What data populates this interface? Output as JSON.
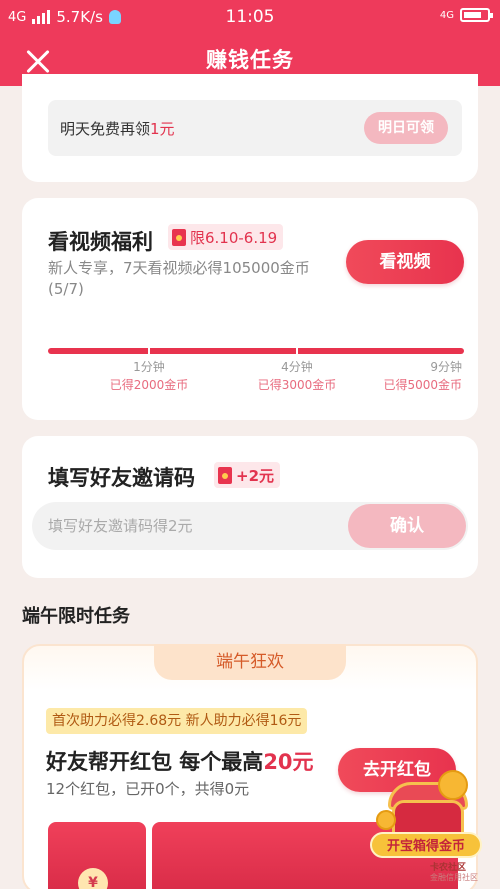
{
  "status_bar": {
    "network_left": "4G",
    "speed": "5.7K/s",
    "time": "11:05",
    "network_right": "4G"
  },
  "header": {
    "title": "赚钱任务"
  },
  "daily_free": {
    "text_prefix": "明天免费再领",
    "amount": "1元",
    "button_label": "明日可领"
  },
  "video_welfare": {
    "title": "看视频福利",
    "tag": "限6.10-6.19",
    "description": "新人专享，7天看视频必得105000金币(5/7)",
    "button_label": "看视频",
    "milestones": [
      {
        "time": "1分钟",
        "reward": "已得2000金币"
      },
      {
        "time": "4分钟",
        "reward": "已得3000金币"
      },
      {
        "time": "9分钟",
        "reward": "已得5000金币"
      }
    ]
  },
  "invite_code": {
    "title": "填写好友邀请码",
    "tag": "+2元",
    "placeholder": "填写好友邀请码得2元",
    "value": "",
    "button_label": "确认"
  },
  "festival_section": {
    "title": "端午限时任务",
    "ribbon": "端午狂欢",
    "note": "首次助力必得2.68元 新人助力必得16元",
    "task_title_prefix": "好友帮开红包 每个最高",
    "task_title_highlight": "20元",
    "subtitle": "12个红包，已开0个，共得0元",
    "button_label": "去开红包",
    "envelope_symbol": "¥"
  },
  "floating_treasure": {
    "label": "开宝箱得金币"
  },
  "watermark": {
    "name": "卡农社区",
    "subtitle": "金融信用社区"
  },
  "colors": {
    "brand_red": "#ee3a5b",
    "button_red": "#e8334e",
    "disabled_pink": "#f4b8c0",
    "page_bg": "#f6eeeb"
  }
}
